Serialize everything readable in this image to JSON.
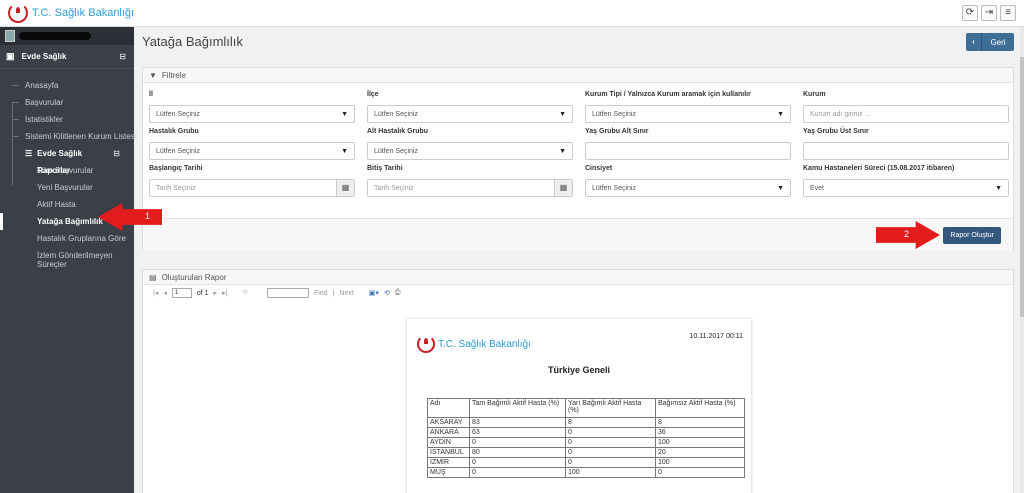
{
  "header": {
    "logo_text": "T.C. Sağlık Bakanlığı",
    "icons": [
      "refresh-icon",
      "logout-icon",
      "menu-icon"
    ]
  },
  "sidebar": {
    "module": "Evde Sağlık",
    "items": [
      "Anasayfa",
      "Başvurular",
      "İstatistikler",
      "Sistemi Kilitlenen Kurum Listesi"
    ],
    "group": "Evde Sağlık Raporlar",
    "sub_items": [
      "Tüm Başvurular",
      "Yeni Başvurular",
      "Aktif Hasta",
      "Yatağa Bağımlılık",
      "Hastalık Gruplarına Göre"
    ],
    "sub_item_last": [
      "İzlem Gönderilmeyen",
      "Süreçler"
    ],
    "toggle": "⊟"
  },
  "page": {
    "title": "Yatağa Bağımlılık",
    "back_label": "Geri"
  },
  "filters": {
    "title": "Filtrele",
    "il": {
      "label": "İl",
      "value": "Lütfen Seçiniz"
    },
    "ilce": {
      "label": "İlçe",
      "value": "Lütfen Seçiniz"
    },
    "kurum_tipi": {
      "label": "Kurum Tipi / Yalnızca Kurum aramak için kullanılır",
      "value": "Lütfen Seçiniz"
    },
    "kurum": {
      "label": "Kurum",
      "placeholder": "Kurum adı giriniz ..."
    },
    "hastalik_grubu": {
      "label": "Hastalık Grubu",
      "value": "Lütfen Seçiniz"
    },
    "alt_hastalik": {
      "label": "Alt Hastalık Grubu",
      "value": "Lütfen Seçiniz"
    },
    "yas_alt": {
      "label": "Yaş Grubu Alt Sınır",
      "value": ""
    },
    "yas_ust": {
      "label": "Yaş Grubu Üst Sınır",
      "value": ""
    },
    "baslangic": {
      "label": "Başlangıç Tarihi",
      "placeholder": "Tarih Seçiniz"
    },
    "bitis": {
      "label": "Bitiş Tarihi",
      "placeholder": "Tarih Seçiniz"
    },
    "cinsiyet": {
      "label": "Cinsiyet",
      "value": "Lütfen Seçiniz"
    },
    "kamu": {
      "label": "Kamu Hastaneleri Süreci (15.08.2017 itibaren)",
      "value": "Evet"
    },
    "submit_label": "Rapor Oluştur"
  },
  "report": {
    "title": "Oluşturulan Rapor",
    "toolbar": {
      "page": "1",
      "of": "of 1",
      "find": "Find",
      "sep": "|",
      "next": "Next"
    },
    "doc": {
      "datetime": "10.11.2017 00:11",
      "logo_text": "T.C. Sağlık Bakanlığı",
      "heading": "Türkiye Geneli",
      "columns": [
        "Adı",
        "Tam Bağımlı Aktif Hasta (%)",
        "Yarı Bağımlı Aktif Hasta (%)",
        "Bağımsız Aktif Hasta (%)"
      ],
      "rows": [
        [
          "AKSARAY",
          "83",
          "8",
          "8"
        ],
        [
          "ANKARA",
          "63",
          "0",
          "36"
        ],
        [
          "AYDIN",
          "0",
          "0",
          "100"
        ],
        [
          "İSTANBUL",
          "80",
          "0",
          "20"
        ],
        [
          "İZMİR",
          "0",
          "0",
          "100"
        ],
        [
          "MUŞ",
          "0",
          "100",
          "0"
        ]
      ]
    }
  },
  "annotations": {
    "arrow1": "1",
    "arrow2": "2"
  },
  "colors": {
    "sidebar": "#3b3f48",
    "primary_button": "#33577d",
    "arrow": "#e21c1c",
    "logo": "#2d9bd3"
  }
}
